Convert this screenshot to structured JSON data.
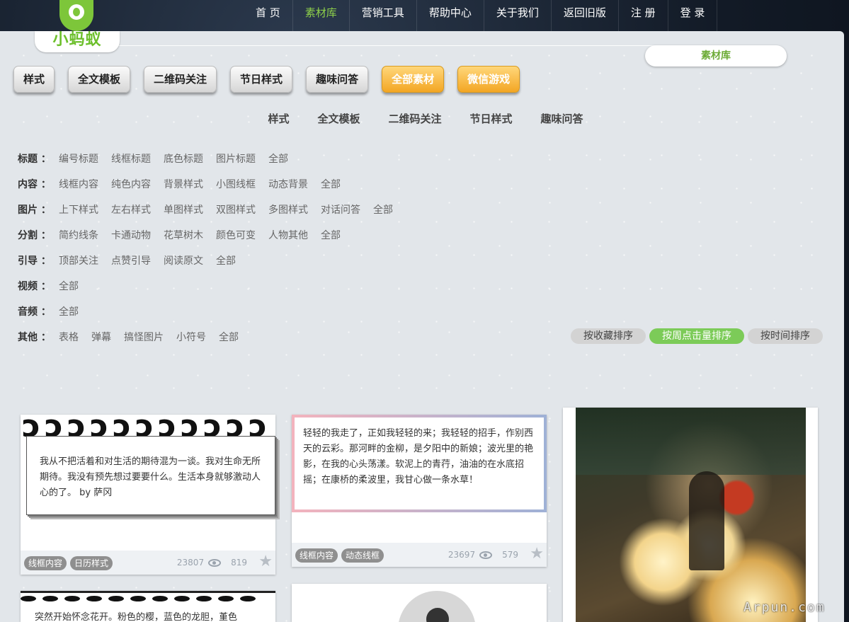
{
  "brand": {
    "name": "小蚂蚁",
    "tab": "素材库"
  },
  "nav": [
    {
      "label": "首 页"
    },
    {
      "label": "素材库"
    },
    {
      "label": "营销工具"
    },
    {
      "label": "帮助中心"
    },
    {
      "label": "关于我们"
    },
    {
      "label": "返回旧版"
    },
    {
      "label": "注 册"
    },
    {
      "label": "登 录"
    }
  ],
  "categories": [
    {
      "label": "样式"
    },
    {
      "label": "全文模板"
    },
    {
      "label": "二维码关注"
    },
    {
      "label": "节日样式"
    },
    {
      "label": "趣味问答"
    },
    {
      "label": "全部素材"
    },
    {
      "label": "微信游戏"
    }
  ],
  "subnav": [
    {
      "label": "样式"
    },
    {
      "label": "全文模板"
    },
    {
      "label": "二维码关注"
    },
    {
      "label": "节日样式"
    },
    {
      "label": "趣味问答"
    }
  ],
  "filters": [
    {
      "label": "标题 ：",
      "options": [
        "编号标题",
        "线框标题",
        "底色标题",
        "图片标题",
        "全部"
      ]
    },
    {
      "label": "内容 ：",
      "options": [
        "线框内容",
        "纯色内容",
        "背景样式",
        "小图线框",
        "动态背景",
        "全部"
      ]
    },
    {
      "label": "图片 ：",
      "options": [
        "上下样式",
        "左右样式",
        "单图样式",
        "双图样式",
        "多图样式",
        "对话问答",
        "全部"
      ]
    },
    {
      "label": "分割 ：",
      "options": [
        "简约线条",
        "卡通动物",
        "花草树木",
        "颜色可变",
        "人物其他",
        "全部"
      ]
    },
    {
      "label": "引导 ：",
      "options": [
        "顶部关注",
        "点赞引导",
        "阅读原文",
        "全部"
      ]
    },
    {
      "label": "视频 ：",
      "options": [
        "全部"
      ]
    },
    {
      "label": "音频 ：",
      "options": [
        "全部"
      ]
    },
    {
      "label": "其他 ：",
      "options": [
        "表格",
        "弹幕",
        "搞怪图片",
        "小符号",
        "全部"
      ]
    }
  ],
  "sorts": [
    {
      "label": "按收藏排序"
    },
    {
      "label": "按周点击量排序"
    },
    {
      "label": "按时间排序"
    }
  ],
  "cards": [
    {
      "text": "我从不把活着和对生活的期待混为一谈。我对生命无所期待。我没有预先想过要要什么。生活本身就够激动人心的了。 by 萨冈",
      "tags": [
        "线框内容",
        "日历样式"
      ],
      "views": "23807",
      "favs": "819"
    },
    {
      "text": "轻轻的我走了，正如我轻轻的来；我轻轻的招手，作别西天的云彩。那河畔的金柳，是夕阳中的新娘；波光里的艳影，在我的心头荡漾。软泥上的青荇，油油的在水底招摇；在康桥的柔波里，我甘心做一条水草！",
      "tags": [
        "线框内容",
        "动态线框"
      ],
      "views": "23697",
      "favs": "579"
    },
    {
      "text": "突然开始怀念花开。粉色的樱，蓝色的龙胆，堇色"
    }
  ],
  "watermark": "Arpun.com",
  "colors": {
    "accent": "#7dc63a",
    "orange": "#f3a624",
    "sortActive": "#7ccb58"
  }
}
